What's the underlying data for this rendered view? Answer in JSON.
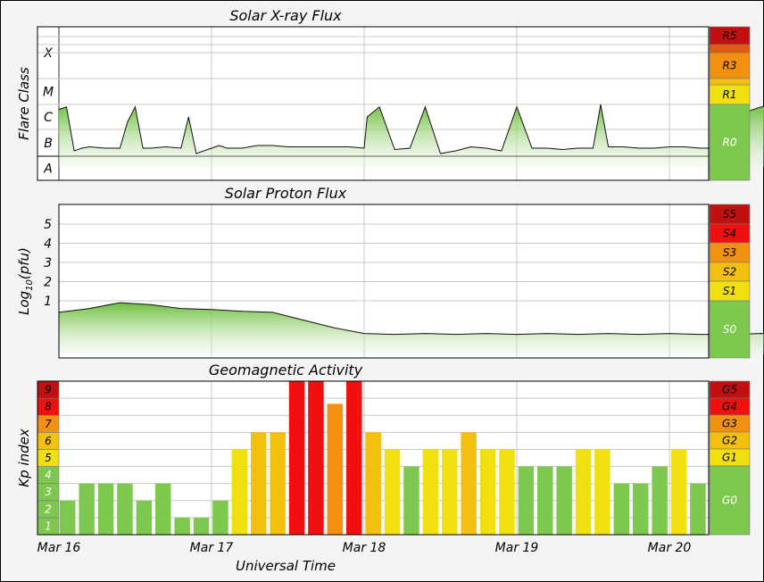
{
  "chart_data": [
    {
      "type": "area",
      "title": "Solar X-ray Flux",
      "ylabel": "Flare Class",
      "y_categories": [
        "A",
        "B",
        "C",
        "M",
        "X"
      ],
      "ylim": [
        -8,
        -3
      ],
      "x_ticks": [
        "Mar 16",
        "Mar 17",
        "Mar 18",
        "Mar 19",
        "Mar 20"
      ],
      "series": [
        {
          "x": [
            0,
            0.05,
            0.1,
            0.15,
            0.2,
            0.3,
            0.4,
            0.45,
            0.5,
            0.55,
            0.6,
            0.7,
            0.8,
            0.85,
            0.9,
            1.0,
            1.05,
            1.1,
            1.2,
            1.3,
            1.4,
            1.5,
            1.6,
            1.7,
            1.8,
            1.9,
            2.0,
            2.02,
            2.1,
            2.2,
            2.3,
            2.4,
            2.5,
            2.6,
            2.7,
            2.8,
            2.9,
            3.0,
            3.1,
            3.2,
            3.3,
            3.4,
            3.5,
            3.55,
            3.6,
            3.7,
            3.8,
            3.9,
            4.0,
            4.1,
            4.2,
            4.3,
            4.4,
            4.45,
            4.5,
            4.6,
            4.7,
            4.8,
            4.85
          ],
          "values": [
            -5.8,
            -5.9,
            -6.2,
            -6.3,
            -6.35,
            -6.3,
            -6.3,
            -5.3,
            -5.9,
            -6.3,
            -6.3,
            -6.35,
            -6.3,
            -5.5,
            -6.1,
            -6.3,
            -6.4,
            -6.3,
            -6.3,
            -6.4,
            -6.4,
            -6.35,
            -6.35,
            -6.35,
            -6.35,
            -6.35,
            -6.3,
            -5.5,
            -5.9,
            -6.25,
            -6.3,
            -5.9,
            -6.1,
            -6.2,
            -6.35,
            -6.3,
            -6.2,
            -5.9,
            -6.3,
            -6.3,
            -6.25,
            -6.3,
            -6.3,
            -6.0,
            -6.35,
            -6.35,
            -6.3,
            -6.3,
            -6.35,
            -6.35,
            -6.3,
            -6.3,
            -6.3,
            -5.4,
            -5.7,
            -5.9,
            -6.0,
            -6.0,
            -6.0
          ]
        }
      ],
      "scale_labels": [
        {
          "label": "R5",
          "color": "#c01010"
        },
        {
          "label": "R3",
          "color": "#f29010"
        },
        {
          "label": "R1",
          "color": "#f0e010"
        },
        {
          "label": "R0",
          "color": "#7ec850"
        }
      ]
    },
    {
      "type": "area",
      "title": "Solar Proton Flux",
      "ylabel": "Log10(pfu)",
      "yticks": [
        1,
        2,
        3,
        4,
        5
      ],
      "ylim": [
        -2,
        6
      ],
      "x_ticks": [
        "Mar 16",
        "Mar 17",
        "Mar 18",
        "Mar 19",
        "Mar 20"
      ],
      "series": [
        {
          "x": [
            0,
            0.2,
            0.4,
            0.6,
            0.8,
            1.0,
            1.2,
            1.4,
            1.6,
            1.8,
            2.0,
            2.2,
            2.4,
            2.6,
            2.8,
            3.0,
            3.2,
            3.4,
            3.6,
            3.8,
            4.0,
            4.2,
            4.4,
            4.6,
            4.8,
            4.9
          ],
          "values": [
            0.4,
            0.6,
            0.9,
            0.8,
            0.6,
            0.55,
            0.45,
            0.4,
            0.0,
            -0.4,
            -0.7,
            -0.75,
            -0.7,
            -0.75,
            -0.7,
            -0.75,
            -0.7,
            -0.75,
            -0.7,
            -0.75,
            -0.7,
            -0.75,
            -0.75,
            -0.7,
            -0.75,
            -0.75
          ]
        }
      ],
      "scale_labels": [
        {
          "label": "S5",
          "color": "#c01010"
        },
        {
          "label": "S4",
          "color": "#f01010"
        },
        {
          "label": "S3",
          "color": "#f29010"
        },
        {
          "label": "S2",
          "color": "#f4c010"
        },
        {
          "label": "S1",
          "color": "#f0e010"
        },
        {
          "label": "S0",
          "color": "#7ec850"
        }
      ]
    },
    {
      "type": "bar",
      "title": "Geomagnetic Activity",
      "ylabel": "Kp index",
      "xlabel": "Universal Time",
      "ylim": [
        0,
        9
      ],
      "y_ticks": [
        "1",
        "2",
        "3",
        "4",
        "5",
        "6",
        "7",
        "8",
        "9"
      ],
      "x_ticks": [
        "Mar 16",
        "Mar 17",
        "Mar 18",
        "Mar 19",
        "Mar 20"
      ],
      "values": [
        2,
        3,
        3,
        3,
        2,
        3,
        1,
        1,
        2,
        5,
        6,
        6,
        9,
        9,
        7.67,
        9,
        6,
        5,
        4,
        5,
        5,
        6,
        5,
        5,
        4,
        4,
        4,
        5,
        5,
        3,
        3,
        4,
        5,
        3
      ],
      "scale_labels": [
        {
          "label": "G5",
          "color": "#c01010"
        },
        {
          "label": "G4",
          "color": "#f01010"
        },
        {
          "label": "G3",
          "color": "#f29010"
        },
        {
          "label": "G2",
          "color": "#f4c010"
        },
        {
          "label": "G1",
          "color": "#f0e010"
        },
        {
          "label": "G0",
          "color": "#7ec850"
        }
      ]
    }
  ]
}
